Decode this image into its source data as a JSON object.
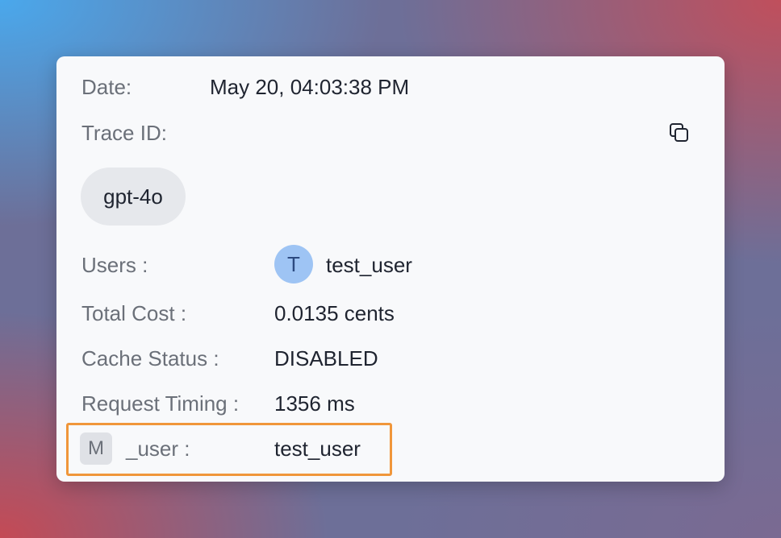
{
  "details": {
    "date_label": "Date:",
    "date_value": "May 20, 04:03:38 PM",
    "trace_id_label": "Trace ID:",
    "copy_icon": "copy-icon",
    "model": "gpt-4o",
    "users_label": "Users :",
    "user_avatar_initial": "T",
    "user_name": "test_user",
    "total_cost_label": "Total Cost :",
    "total_cost_value": "0.0135 cents",
    "cache_status_label": "Cache Status :",
    "cache_status_value": "DISABLED",
    "request_timing_label": "Request Timing :",
    "request_timing_value": "1356 ms"
  },
  "metadata": {
    "badge": "M",
    "key_label": "_user :",
    "value": "test_user",
    "highlight_color": "#f0963a"
  }
}
